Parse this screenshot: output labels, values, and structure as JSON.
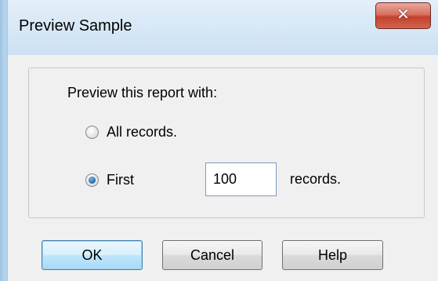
{
  "window": {
    "title": "Preview Sample",
    "close_glyph": "✕"
  },
  "options": {
    "prompt": "Preview this report with:",
    "all_label": "All records.",
    "first_label": "First",
    "selected": "first",
    "count_value": "100",
    "records_suffix": "records."
  },
  "buttons": {
    "ok": "OK",
    "cancel": "Cancel",
    "help": "Help"
  }
}
